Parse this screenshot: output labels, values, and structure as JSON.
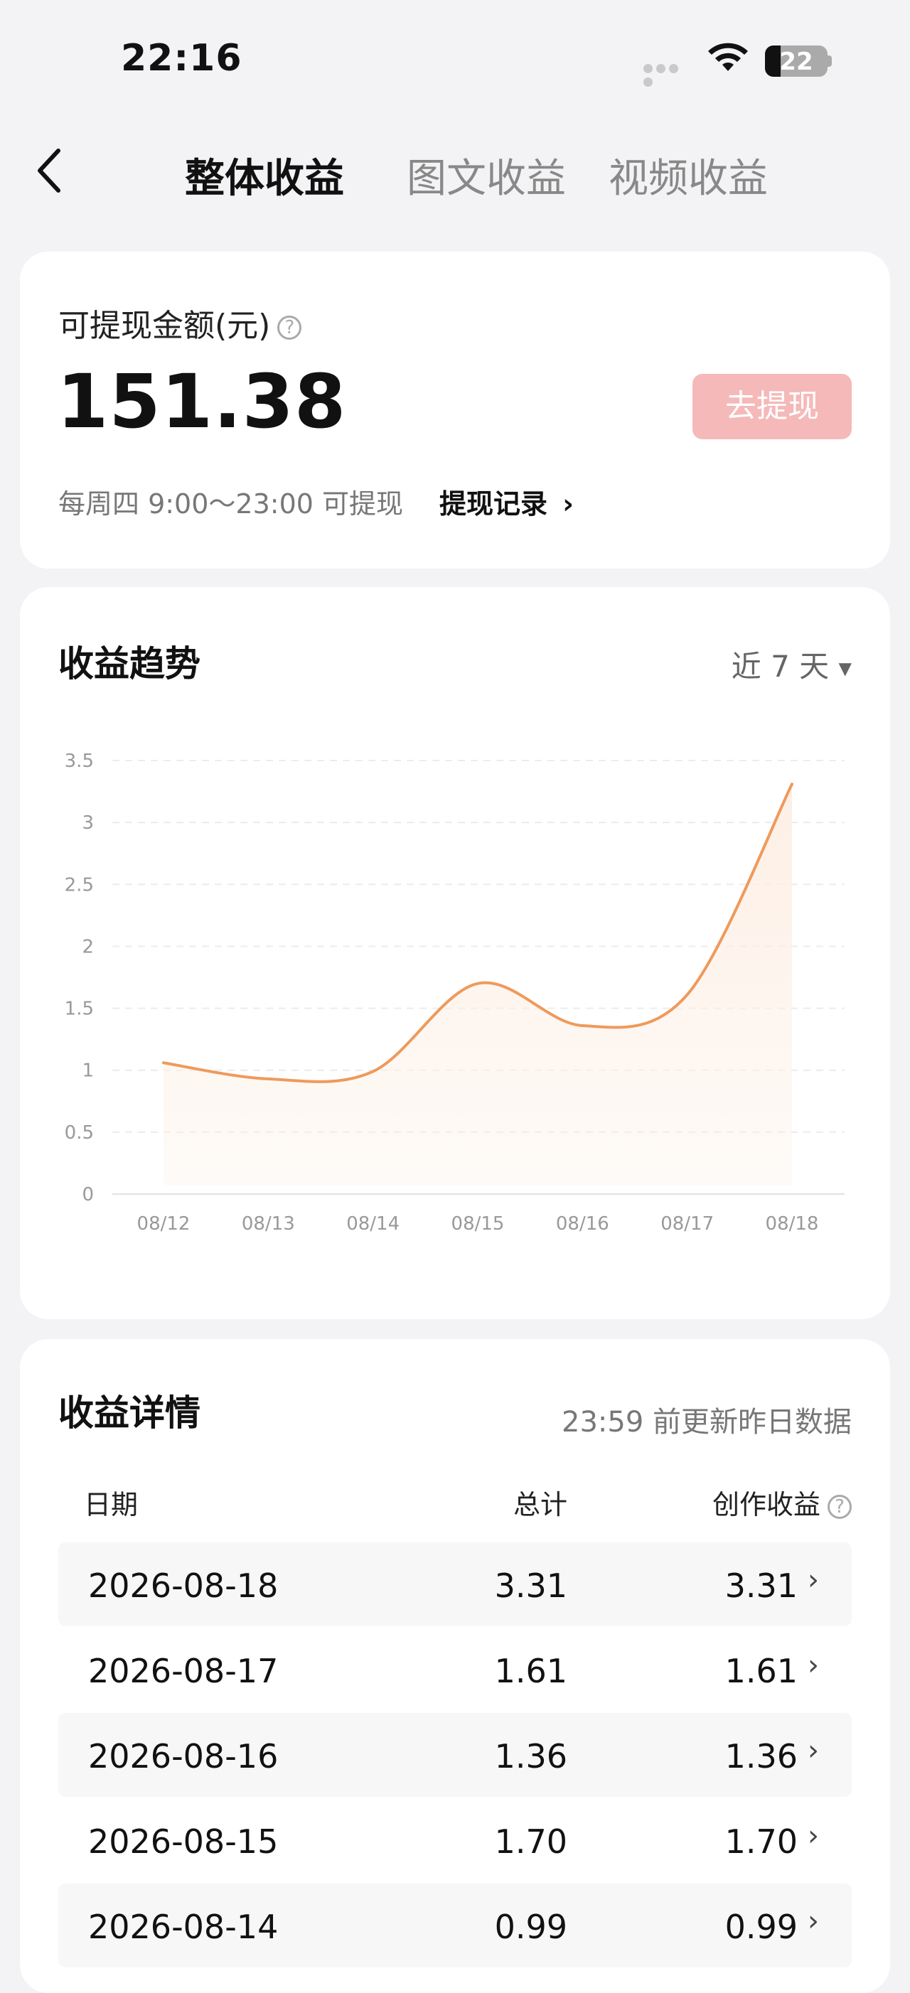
{
  "status": {
    "time": "22:16",
    "battery": "22"
  },
  "nav": {
    "tabs": [
      "整体收益",
      "图文收益",
      "视频收益"
    ]
  },
  "balance": {
    "label": "可提现金额(元)",
    "amount": "151.38",
    "withdraw_button": "去提现",
    "note": "每周四 9:00～23:00 可提现",
    "record_link": "提现记录"
  },
  "trend": {
    "title": "收益趋势",
    "range": "近 7 天"
  },
  "chart_data": {
    "type": "area",
    "x": [
      "08/12",
      "08/13",
      "08/14",
      "08/15",
      "08/16",
      "08/17",
      "08/18"
    ],
    "values": [
      1.06,
      0.93,
      0.99,
      1.7,
      1.36,
      1.61,
      3.31
    ],
    "ylim": [
      0,
      3.5
    ],
    "yticks": [
      "0",
      "0.5",
      "1",
      "1.5",
      "2",
      "2.5",
      "3",
      "3.5"
    ],
    "line_color": "#ee9a5c",
    "fill_color": "#fdeee3",
    "grid": true
  },
  "details": {
    "title": "收益详情",
    "subtitle": "23:59 前更新昨日数据",
    "headers": {
      "date": "日期",
      "total": "总计",
      "creation": "创作收益"
    },
    "rows": [
      {
        "date": "2026-08-18",
        "total": "3.31",
        "creation": "3.31"
      },
      {
        "date": "2026-08-17",
        "total": "1.61",
        "creation": "1.61"
      },
      {
        "date": "2026-08-16",
        "total": "1.36",
        "creation": "1.36"
      },
      {
        "date": "2026-08-15",
        "total": "1.70",
        "creation": "1.70"
      },
      {
        "date": "2026-08-14",
        "total": "0.99",
        "creation": "0.99"
      }
    ]
  },
  "colors": {
    "accent": "#f5b9b9",
    "chart_line": "#ee9a5c",
    "background": "#f3f3f5"
  }
}
